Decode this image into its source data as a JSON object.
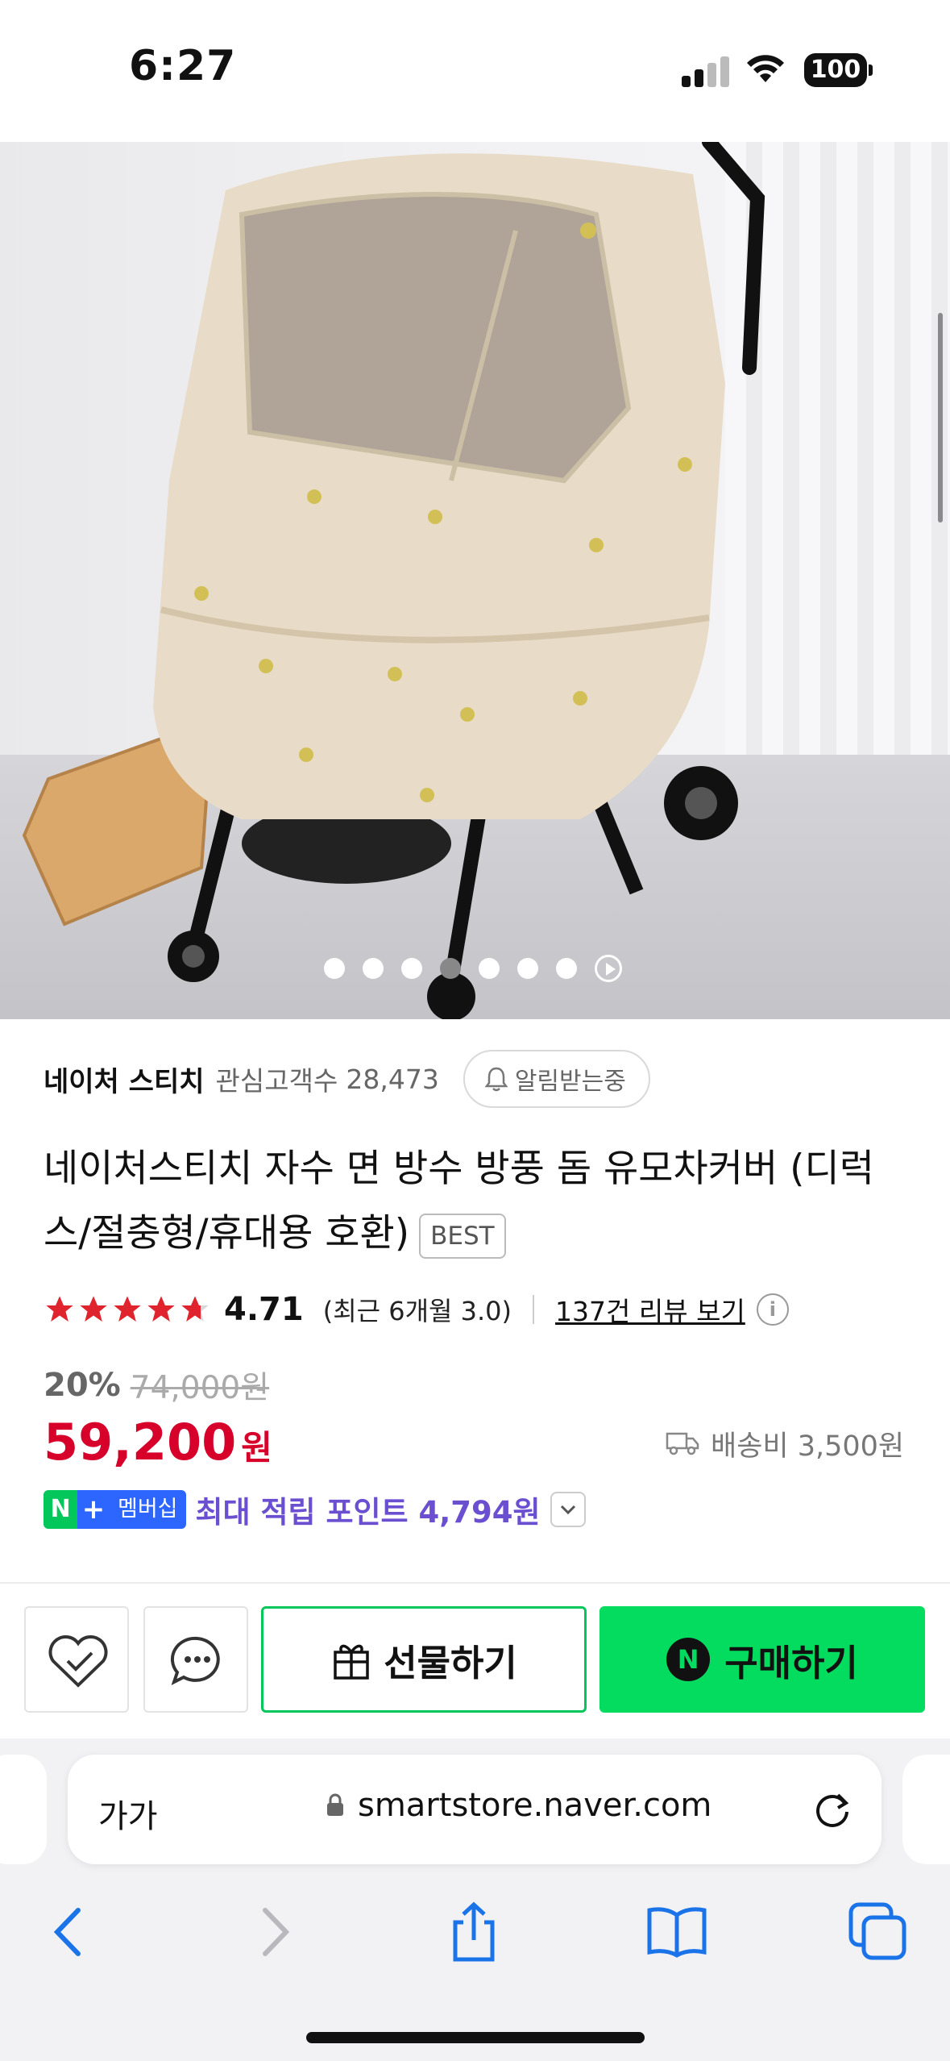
{
  "status_bar": {
    "time": "6:27",
    "battery": "100"
  },
  "gallery": {
    "dot_count": 7,
    "active_dot_index": 3
  },
  "store": {
    "name": "네이처 스티치",
    "follower_label": "관심고객수",
    "follower_count": "28,473",
    "notify_label": "알림받는중"
  },
  "product": {
    "title": "네이처스티치 자수 면 방수 방풍 돔 유모차커버 (디럭스/절충형/휴대용 호환)",
    "badge": "BEST",
    "rating": "4.71",
    "recent_rating": "(최근 6개월 3.0)",
    "review_link": "137건 리뷰 보기",
    "info_icon": "i",
    "discount_rate": "20%",
    "original_price": "74,000원",
    "price": "59,200",
    "currency": "원",
    "shipping": "배송비 3,500원",
    "membership": {
      "n": "N",
      "plus": "+",
      "label": "멤버십"
    },
    "points": "최대 적립 포인트 4,794원",
    "star_rating_value": 4.71
  },
  "actions": {
    "gift_label": "선물하기",
    "buy_label": "구매하기",
    "buy_icon": "N",
    "wish_icon": "heart-check-icon",
    "chat_icon": "chat-bubble-icon"
  },
  "browser": {
    "text_size_label": "가가",
    "url": "smartstore.naver.com"
  },
  "colors": {
    "price_red": "#d6002a",
    "naver_green": "#03c75a",
    "buy_green": "#03dc5f",
    "points_purple": "#6b4fd1",
    "star_red": "#e0242d",
    "safari_blue": "#1a73e8"
  }
}
